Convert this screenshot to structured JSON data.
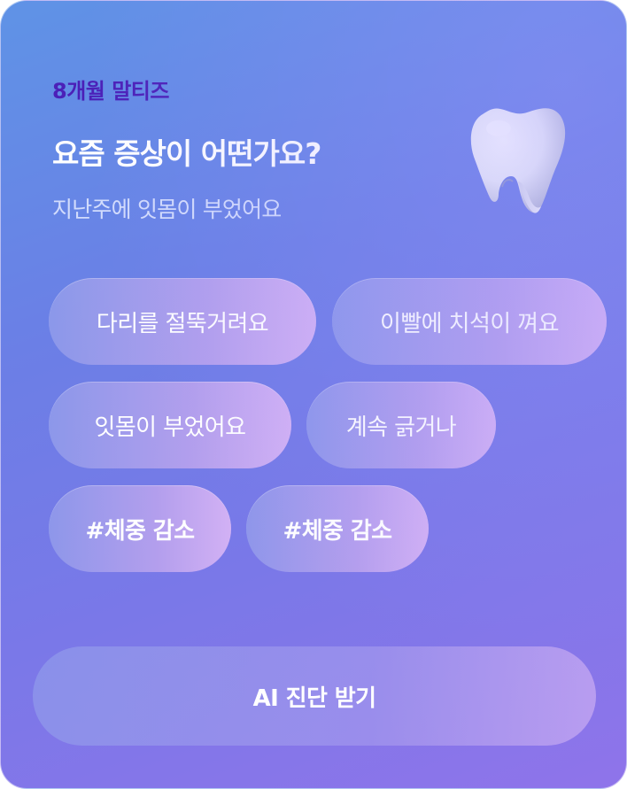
{
  "header": {
    "pet_label": "8개월 말티즈",
    "question": "요즘 증상이 어떤가요?",
    "subtitle": "지난주에 잇몸이 부었어요"
  },
  "symptom_chips": [
    {
      "label": "다리를 절뚝거려요"
    },
    {
      "label": "이빨에 치석이 껴요"
    },
    {
      "label": "잇몸이 부었어요"
    },
    {
      "label": "계속 긁거나"
    },
    {
      "label": "#체중 감소"
    },
    {
      "label": "#체중 감소"
    }
  ],
  "cta": {
    "label": "AI 진단 받기"
  },
  "icons": {
    "hero": "tooth-icon"
  },
  "colors": {
    "pet_label": "#4b20b8",
    "background_start": "#5f93e6",
    "background_end": "#8f74ea"
  }
}
